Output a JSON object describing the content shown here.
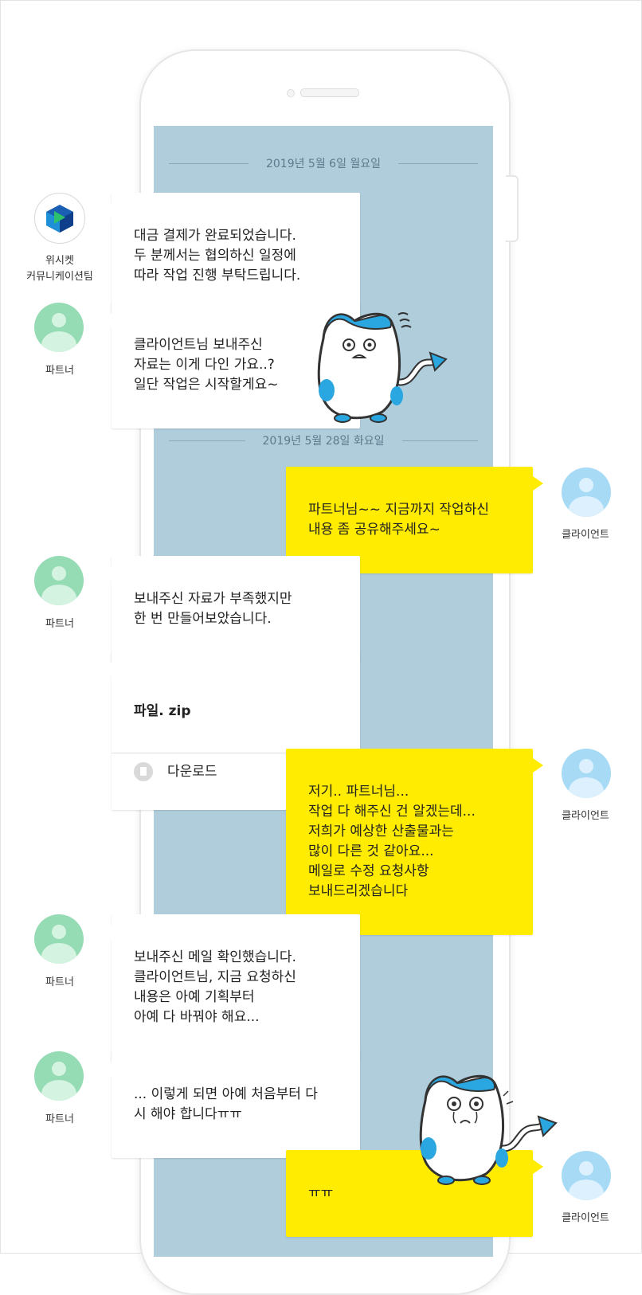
{
  "dates": [
    "2019년 5월 6일 월요일",
    "2019년 5월 28일 화요일"
  ],
  "names": {
    "team_line1": "위시켓",
    "team_line2": "커뮤니케이션팀",
    "partner": "파트너",
    "client": "클라이언트"
  },
  "messages": {
    "m1": "대금 결제가 완료되었습니다.\n두 분께서는 협의하신 일정에\n따라 작업 진행 부탁드립니다.",
    "m2": "클라이언트님 보내주신\n자료는 이게 다인 가요..?\n일단 작업은 시작할게요~",
    "m3": "파트너님~~ 지금까지 작업하신\n내용 좀 공유해주세요~",
    "m4": "보내주신 자료가 부족했지만\n한 번 만들어보았습니다.",
    "m6": "저기.. 파트너님...\n작업 다 해주신 건 알겠는데...\n저희가 예상한 산출물과는\n많이 다른 것 같아요...\n메일로 수정 요청사항\n보내드리겠습니다",
    "m7": "보내주신 메일 확인했습니다.\n클라이언트님, 지금 요청하신\n내용은 아예 기획부터\n아예 다 바꿔야 해요...",
    "m8": "... 이렇게 되면 아예 처음부터 다\n시 해야 합니다ㅠㅠ",
    "m9": "ㅠㅠ"
  },
  "file": {
    "name": "파일. zip",
    "download_label": "다운로드"
  },
  "colors": {
    "screen": "#b0cddc",
    "client_bubble": "#ffec00",
    "partner_avatar": "#95dbb4",
    "client_avatar": "#a7daf5"
  }
}
